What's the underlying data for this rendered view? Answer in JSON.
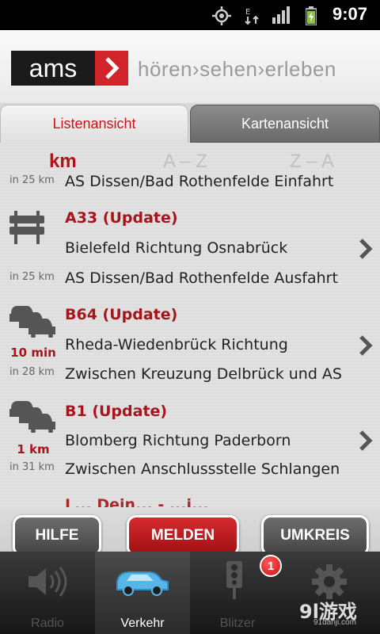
{
  "status_bar": {
    "time": "9:07",
    "icons": [
      "gps-icon",
      "data-transfer-icon",
      "signal-icon",
      "battery-charging-icon"
    ]
  },
  "header": {
    "logo_text": "ams",
    "slogan": "hören›sehen›erleben"
  },
  "tabs": [
    {
      "label": "Listenansicht",
      "active": true
    },
    {
      "label": "Kartenansicht",
      "active": false
    }
  ],
  "sort": {
    "km": "km",
    "az": "A – Z",
    "za": "Z – A"
  },
  "entries": [
    {
      "title": "",
      "line1": "",
      "line2": "AS Dissen/Bad Rothenfelde Einfahrt",
      "distance": "in 25 km",
      "icon": "none"
    },
    {
      "title": "A33 (Update)",
      "line1": "Bielefeld Richtung Osnabrück",
      "line2": "AS Dissen/Bad Rothenfelde Ausfahrt",
      "distance": "in 25 km",
      "icon": "road-closure-icon"
    },
    {
      "title": "B64 (Update)",
      "line1": "Rheda-Wiedenbrück Richtung",
      "line2": "Zwischen Kreuzung Delbrück und AS",
      "distance": "in 28 km",
      "extra": "10 min",
      "icon": "traffic-jam-icon"
    },
    {
      "title": "B1 (Update)",
      "line1": "Blomberg Richtung Paderborn",
      "line2": "Zwischen Anschlussstelle Schlangen",
      "distance": "in 31 km",
      "extra": "1 km",
      "icon": "traffic-jam-icon"
    }
  ],
  "partial_entry_title": "L... Dein... - ...i...",
  "buttons": {
    "help": "HILFE",
    "report": "MELDEN",
    "radius": "UMKREIS"
  },
  "bottom_nav": [
    {
      "label": "Radio",
      "icon": "speaker-icon",
      "active": false
    },
    {
      "label": "Verkehr",
      "icon": "car-icon",
      "active": true
    },
    {
      "label": "Blitzer",
      "icon": "traffic-light-icon",
      "active": false,
      "badge": "1"
    },
    {
      "label": "",
      "icon": "gear-icon",
      "active": false
    }
  ],
  "watermark": {
    "main": "9l游戏",
    "sub": "91danji.com"
  },
  "colors": {
    "accent_red": "#c4161c",
    "title_red": "#a6151b"
  }
}
